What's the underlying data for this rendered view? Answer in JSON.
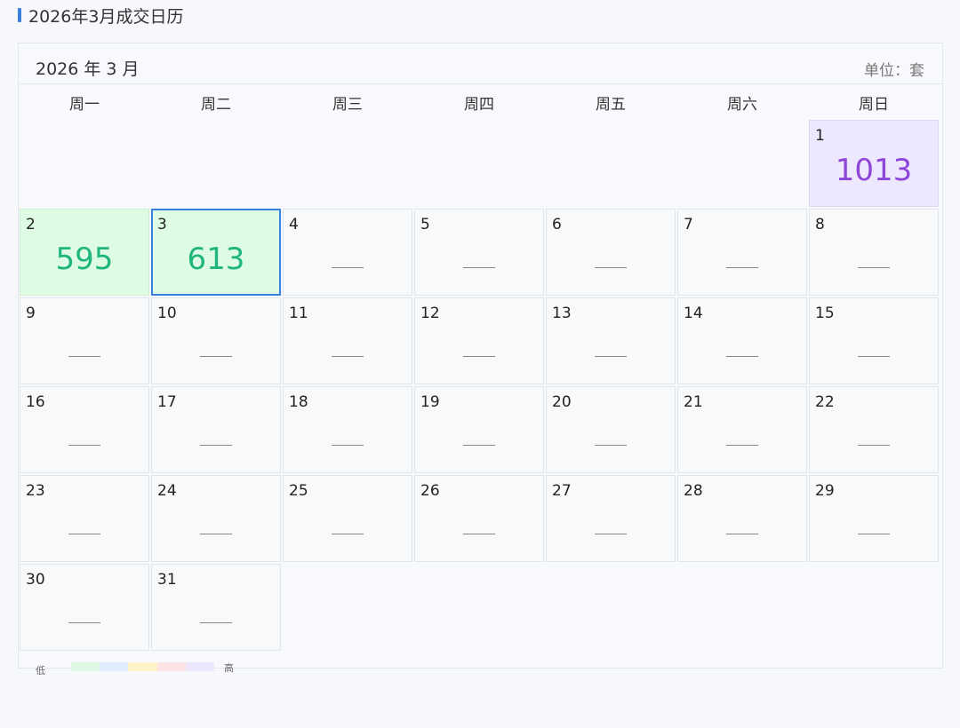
{
  "page": {
    "title": "2026年3月成交日历"
  },
  "calendar": {
    "month_label": "2026 年 3 月",
    "unit_label": "单位：套",
    "weekdays": [
      "周一",
      "周二",
      "周三",
      "周四",
      "周五",
      "周六",
      "周日"
    ],
    "empty_marker": "——",
    "first_weekday_index": 6,
    "selected_day": 3,
    "days": [
      {
        "day": "1",
        "value": "1013",
        "level": 5
      },
      {
        "day": "2",
        "value": "595",
        "level": 1
      },
      {
        "day": "3",
        "value": "613",
        "level": 1
      },
      {
        "day": "4",
        "value": null,
        "level": 0
      },
      {
        "day": "5",
        "value": null,
        "level": 0
      },
      {
        "day": "6",
        "value": null,
        "level": 0
      },
      {
        "day": "7",
        "value": null,
        "level": 0
      },
      {
        "day": "8",
        "value": null,
        "level": 0
      },
      {
        "day": "9",
        "value": null,
        "level": 0
      },
      {
        "day": "10",
        "value": null,
        "level": 0
      },
      {
        "day": "11",
        "value": null,
        "level": 0
      },
      {
        "day": "12",
        "value": null,
        "level": 0
      },
      {
        "day": "13",
        "value": null,
        "level": 0
      },
      {
        "day": "14",
        "value": null,
        "level": 0
      },
      {
        "day": "15",
        "value": null,
        "level": 0
      },
      {
        "day": "16",
        "value": null,
        "level": 0
      },
      {
        "day": "17",
        "value": null,
        "level": 0
      },
      {
        "day": "18",
        "value": null,
        "level": 0
      },
      {
        "day": "19",
        "value": null,
        "level": 0
      },
      {
        "day": "20",
        "value": null,
        "level": 0
      },
      {
        "day": "21",
        "value": null,
        "level": 0
      },
      {
        "day": "22",
        "value": null,
        "level": 0
      },
      {
        "day": "23",
        "value": null,
        "level": 0
      },
      {
        "day": "24",
        "value": null,
        "level": 0
      },
      {
        "day": "25",
        "value": null,
        "level": 0
      },
      {
        "day": "26",
        "value": null,
        "level": 0
      },
      {
        "day": "27",
        "value": null,
        "level": 0
      },
      {
        "day": "28",
        "value": null,
        "level": 0
      },
      {
        "day": "29",
        "value": null,
        "level": 0
      },
      {
        "day": "30",
        "value": null,
        "level": 0
      },
      {
        "day": "31",
        "value": null,
        "level": 0
      }
    ]
  },
  "legend": {
    "low_label": "低",
    "high_label": "高",
    "colors": [
      "#dff8e6",
      "#e1ecfc",
      "#fdf4c8",
      "#fde3e3",
      "#ece6fc"
    ]
  },
  "colors": {
    "accent": "#3b7ddd",
    "low_value_text": "#1fb57d",
    "high_value_text": "#8d46d8"
  }
}
